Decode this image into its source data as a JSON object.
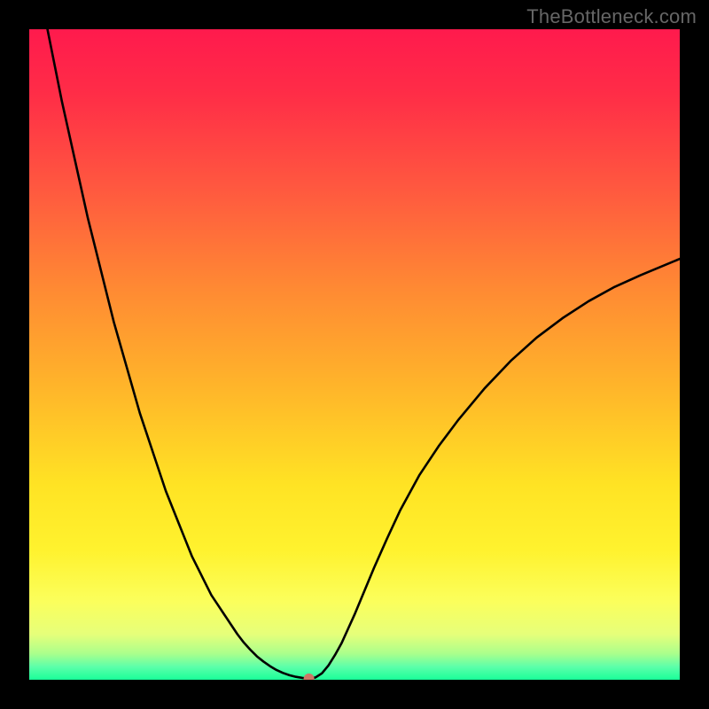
{
  "watermark": "TheBottleneck.com",
  "colors": {
    "frame": "#000000",
    "watermark": "#666666",
    "curve": "#000000",
    "marker": "#cc7766"
  },
  "gradient_stops": [
    {
      "offset": "0%",
      "color": "#ff1a4d"
    },
    {
      "offset": "10%",
      "color": "#ff2d47"
    },
    {
      "offset": "25%",
      "color": "#ff5a3f"
    },
    {
      "offset": "40%",
      "color": "#ff8a33"
    },
    {
      "offset": "55%",
      "color": "#ffb52a"
    },
    {
      "offset": "70%",
      "color": "#ffe324"
    },
    {
      "offset": "80%",
      "color": "#fff22e"
    },
    {
      "offset": "88%",
      "color": "#fbff5c"
    },
    {
      "offset": "93%",
      "color": "#e6ff7a"
    },
    {
      "offset": "96%",
      "color": "#aaff8c"
    },
    {
      "offset": "98%",
      "color": "#5cffaa"
    },
    {
      "offset": "100%",
      "color": "#1aff99"
    }
  ],
  "chart_data": {
    "type": "line",
    "title": "",
    "xlabel": "",
    "ylabel": "",
    "xlim": [
      0,
      100
    ],
    "ylim": [
      0,
      100
    ],
    "x": [
      0,
      1,
      2,
      3,
      4,
      5,
      6,
      7,
      8,
      9,
      10,
      11,
      12,
      13,
      14,
      15,
      16,
      17,
      18,
      19,
      20,
      21,
      22,
      23,
      24,
      25,
      26,
      27,
      28,
      29,
      30,
      31,
      32,
      33,
      34,
      35,
      36,
      37,
      38,
      39,
      40,
      41,
      42,
      43,
      44,
      45,
      46,
      47,
      48,
      49,
      50,
      51,
      52,
      53,
      55,
      57,
      60,
      63,
      66,
      70,
      74,
      78,
      82,
      86,
      90,
      94,
      100
    ],
    "values": [
      115,
      109.5,
      104,
      99,
      94,
      89,
      84.5,
      80,
      75.5,
      71,
      67,
      63,
      59,
      55,
      51.5,
      48,
      44.5,
      41,
      38,
      35,
      32,
      29,
      26.5,
      24,
      21.5,
      19,
      17,
      15,
      13,
      11.5,
      10,
      8.5,
      7,
      5.7,
      4.6,
      3.6,
      2.8,
      2.1,
      1.5,
      1.05,
      0.7,
      0.45,
      0.28,
      0.16,
      0.35,
      1.0,
      2.2,
      3.8,
      5.6,
      7.8,
      10.0,
      12.4,
      14.8,
      17.2,
      21.7,
      26.0,
      31.5,
      36.0,
      40.0,
      44.8,
      49.0,
      52.6,
      55.6,
      58.2,
      60.4,
      62.2,
      64.7
    ],
    "marker": {
      "x": 43,
      "y": 0.16
    },
    "notes": "V-shaped bottleneck curve. Minimum near x≈43. Left branch rises off the top of the plot; right branch asymptotes toward ~65% of plot height."
  }
}
